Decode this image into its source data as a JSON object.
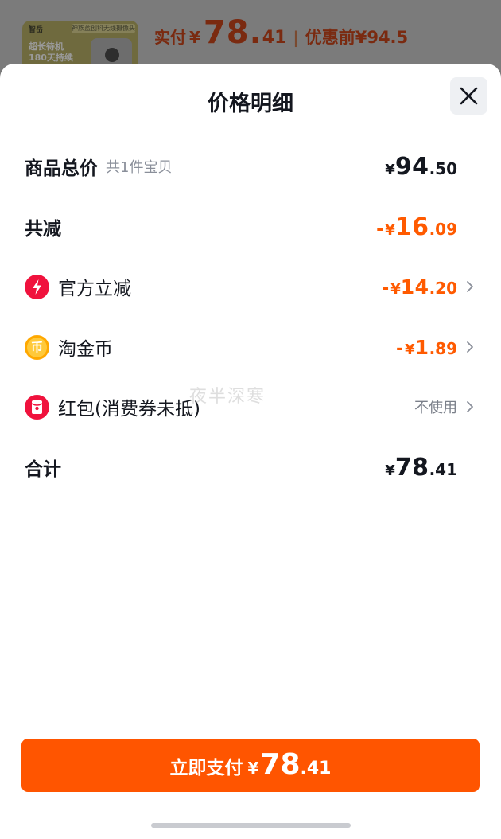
{
  "background_page": {
    "thumbnail": {
      "brand": "智岳",
      "tag": "神族蓝创科无线摄像头",
      "line1": "超长待机",
      "line2": "180天持续"
    },
    "paid_label": "实付",
    "currency": "¥",
    "paid_int": "78.",
    "paid_dec": "41",
    "separator": "|",
    "original_label": "优惠前",
    "original_price": "¥94.5"
  },
  "sheet": {
    "title": "价格明细",
    "watermark": "夜半深寒",
    "rows": [
      {
        "label": "商品总价",
        "sub": "共1件宝贝",
        "currency": "¥",
        "int": "94",
        "dec": ".50"
      },
      {
        "label": "共减",
        "sign": "-",
        "currency": "¥",
        "int": "16",
        "dec": ".09"
      },
      {
        "label": "官方立减",
        "icon": "lightning-icon",
        "sign": "-",
        "currency": "¥",
        "int": "14",
        "dec": ".20"
      },
      {
        "label": "淘金币",
        "icon": "coin-icon",
        "icon_char": "币",
        "sign": "-",
        "currency": "¥",
        "int": "1",
        "dec": ".89"
      },
      {
        "label": "红包(消费券未抵)",
        "icon": "red-packet-icon",
        "value": "不使用"
      },
      {
        "label": "合计",
        "currency": "¥",
        "int": "78",
        "dec": ".41"
      }
    ],
    "pay_button": {
      "label": "立即支付",
      "currency": "¥",
      "int": "78",
      "dec": ".41"
    }
  },
  "colors": {
    "accent": "#ff5500",
    "discount": "#ff5a00",
    "text": "#14171f",
    "muted": "#8a8f9a"
  }
}
